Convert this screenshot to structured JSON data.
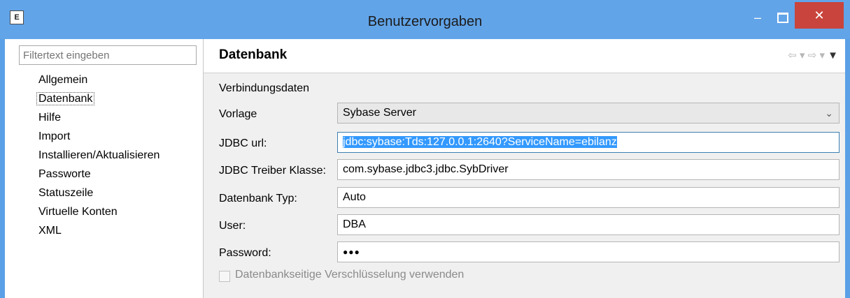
{
  "window": {
    "title": "Benutzervorgaben",
    "app_icon_letter": "E",
    "minimize_symbol": "‒",
    "close_symbol": "✕"
  },
  "sidebar": {
    "filter_placeholder": "Filtertext eingeben",
    "items": [
      {
        "label": "Allgemein"
      },
      {
        "label": "Datenbank",
        "selected": true
      },
      {
        "label": "Hilfe"
      },
      {
        "label": "Import"
      },
      {
        "label": "Installieren/Aktualisieren"
      },
      {
        "label": "Passworte"
      },
      {
        "label": "Statuszeile"
      },
      {
        "label": "Virtuelle Konten"
      },
      {
        "label": "XML"
      }
    ]
  },
  "page": {
    "title": "Datenbank",
    "section": "Verbindungsdaten",
    "fields": {
      "vorlage": {
        "label": "Vorlage",
        "value": "Sybase Server"
      },
      "jdbc_url": {
        "label": "JDBC url:",
        "value": "jdbc:sybase:Tds:127.0.0.1:2640?ServiceName=ebilanz"
      },
      "driver": {
        "label": "JDBC Treiber Klasse:",
        "value": "com.sybase.jdbc3.jdbc.SybDriver"
      },
      "db_type": {
        "label": "Datenbank Typ:",
        "value": "Auto"
      },
      "user": {
        "label": "User:",
        "value": "DBA"
      },
      "password": {
        "label": "Password:",
        "value": "●●●"
      }
    },
    "encryption_checkbox": {
      "label": "Datenbankseitige Verschlüsselung verwenden",
      "checked": false,
      "enabled": false
    }
  },
  "colors": {
    "titlebar": "#62a4e8",
    "close_button": "#c9443c",
    "selection": "#3399ff"
  }
}
